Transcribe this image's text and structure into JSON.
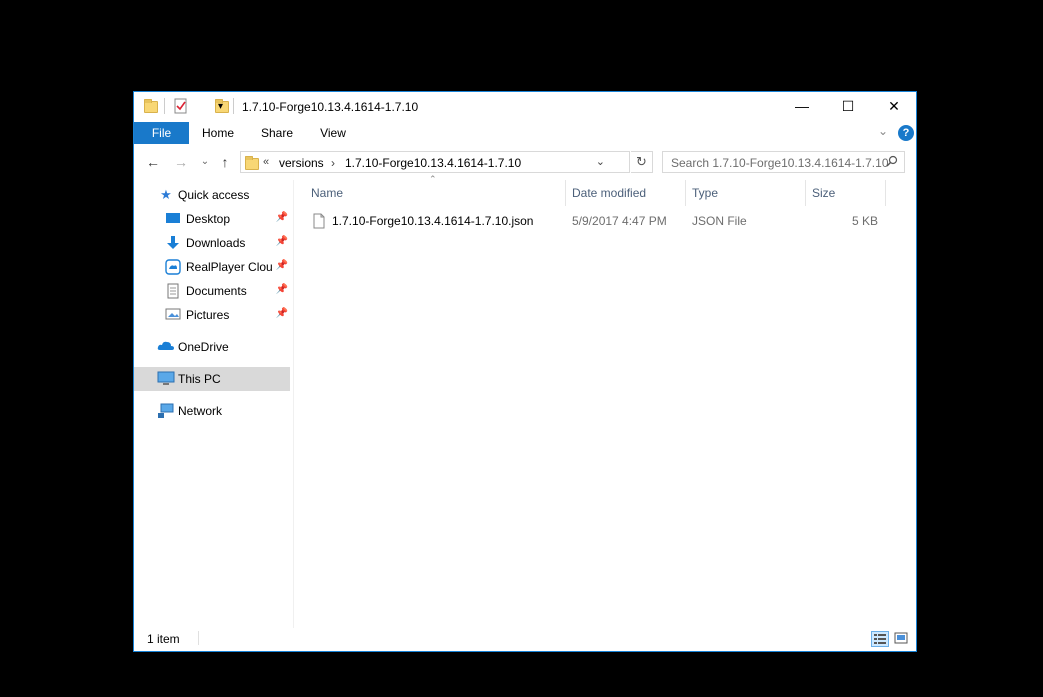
{
  "window": {
    "title": "1.7.10-Forge10.13.4.1614-1.7.10",
    "minimize_symbol": "—",
    "maximize_symbol": "☐",
    "close_symbol": "✕"
  },
  "ribbon": {
    "tabs": [
      {
        "label": "File"
      },
      {
        "label": "Home"
      },
      {
        "label": "Share"
      },
      {
        "label": "View"
      }
    ],
    "help_symbol": "?",
    "expand_symbol": "⌄"
  },
  "address": {
    "overflow": "«",
    "crumbs": [
      "versions",
      "1.7.10-Forge10.13.4.1614-1.7.10"
    ],
    "separator": "›",
    "search_placeholder": "Search 1.7.10-Forge10.13.4.1614-1.7.10"
  },
  "sidebar": {
    "quick_access": "Quick access",
    "quick_items": [
      {
        "label": "Desktop",
        "icon": "desktop-icon"
      },
      {
        "label": "Downloads",
        "icon": "downloads-icon"
      },
      {
        "label": "RealPlayer Clouc",
        "icon": "realplayer-cloud-icon"
      },
      {
        "label": "Documents",
        "icon": "documents-icon"
      },
      {
        "label": "Pictures",
        "icon": "pictures-icon"
      }
    ],
    "onedrive": "OneDrive",
    "this_pc": "This PC",
    "network": "Network"
  },
  "columns": {
    "name": "Name",
    "date_modified": "Date modified",
    "type": "Type",
    "size": "Size"
  },
  "files": [
    {
      "name": "1.7.10-Forge10.13.4.1614-1.7.10.json",
      "date_modified": "5/9/2017 4:47 PM",
      "type": "JSON File",
      "size": "5 KB"
    }
  ],
  "status": {
    "item_count": "1 item"
  },
  "colors": {
    "accent": "#1979ca",
    "border": "#1883d7",
    "selected": "#d9d9d9",
    "header_text": "#4c607a"
  }
}
